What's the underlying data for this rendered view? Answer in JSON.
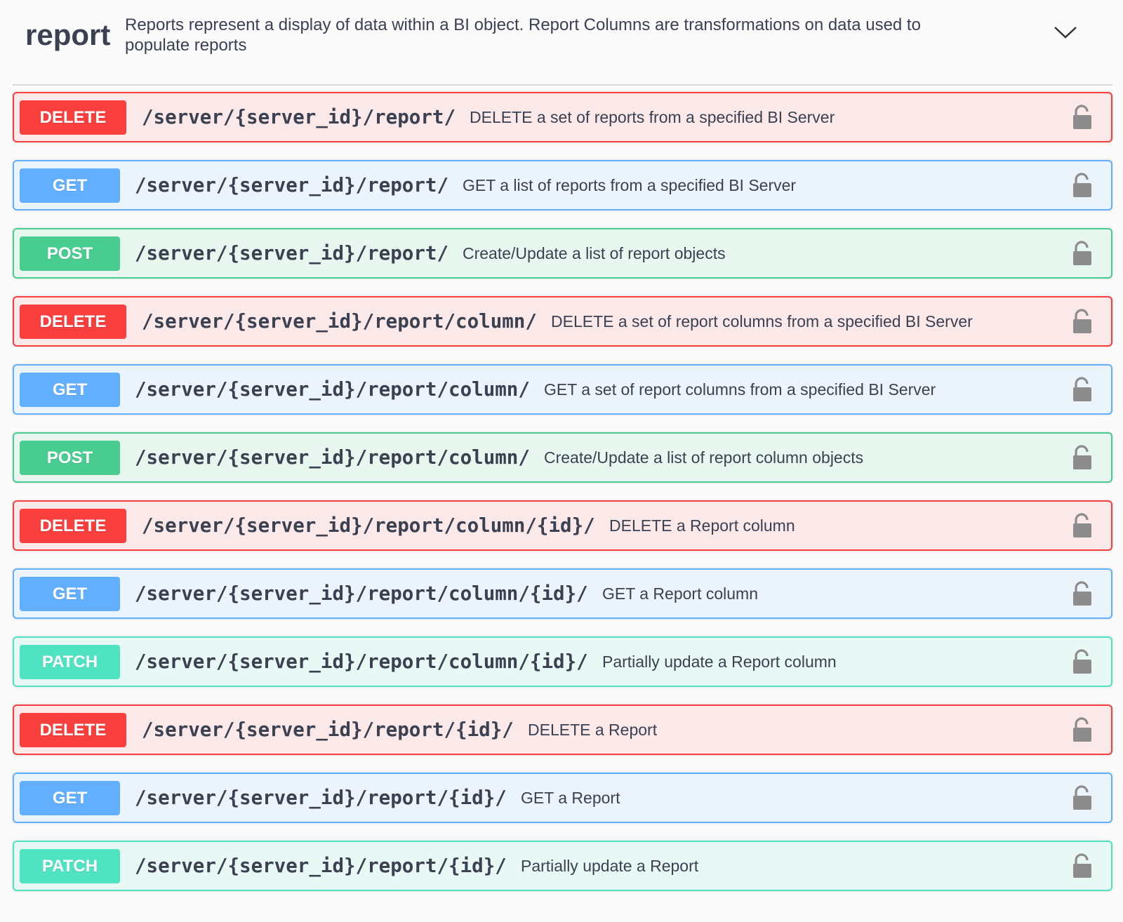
{
  "tag": {
    "name": "report",
    "description": "Reports represent a display of data within a BI object. Report Columns are transformations on data used to populate reports",
    "collapse_icon": "chevron-down-icon"
  },
  "operations": [
    {
      "method": "DELETE",
      "path": "/server/{server_id}/report/",
      "summary": "DELETE a set of reports from a specified BI Server"
    },
    {
      "method": "GET",
      "path": "/server/{server_id}/report/",
      "summary": "GET a list of reports from a specified BI Server"
    },
    {
      "method": "POST",
      "path": "/server/{server_id}/report/",
      "summary": "Create/Update a list of report objects"
    },
    {
      "method": "DELETE",
      "path": "/server/{server_id}/report/column/",
      "summary": "DELETE a set of report columns from a specified BI Server"
    },
    {
      "method": "GET",
      "path": "/server/{server_id}/report/column/",
      "summary": "GET a set of report columns from a specified BI Server"
    },
    {
      "method": "POST",
      "path": "/server/{server_id}/report/column/",
      "summary": "Create/Update a list of report column objects"
    },
    {
      "method": "DELETE",
      "path": "/server/{server_id}/report/column/{id}/",
      "summary": "DELETE a Report column"
    },
    {
      "method": "GET",
      "path": "/server/{server_id}/report/column/{id}/",
      "summary": "GET a Report column"
    },
    {
      "method": "PATCH",
      "path": "/server/{server_id}/report/column/{id}/",
      "summary": "Partially update a Report column"
    },
    {
      "method": "DELETE",
      "path": "/server/{server_id}/report/{id}/",
      "summary": "DELETE a Report"
    },
    {
      "method": "GET",
      "path": "/server/{server_id}/report/{id}/",
      "summary": "GET a Report"
    },
    {
      "method": "PATCH",
      "path": "/server/{server_id}/report/{id}/",
      "summary": "Partially update a Report"
    }
  ],
  "colors": {
    "delete": "#f93e3e",
    "get": "#61affe",
    "post": "#49cc90",
    "patch": "#50e3c2",
    "text": "#3b4151",
    "lock": "#8c8c8c"
  },
  "icons": {
    "lock": "unlocked-padlock-icon"
  }
}
